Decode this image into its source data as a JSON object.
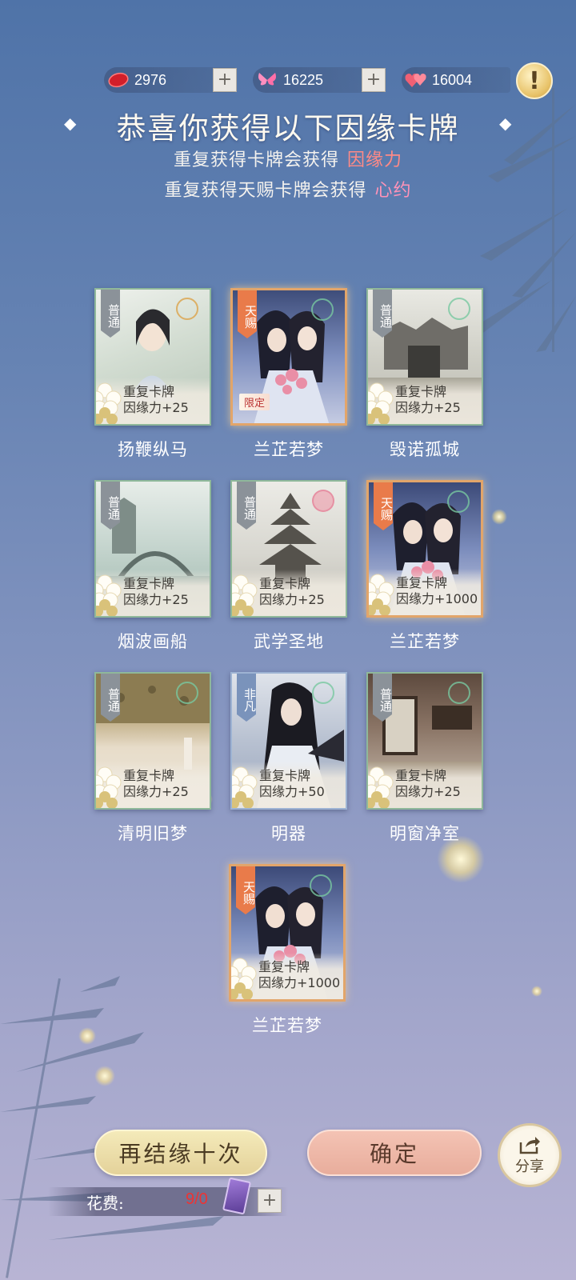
{
  "currencies": [
    {
      "icon": "red-gem-icon",
      "value": "2976",
      "has_plus": true
    },
    {
      "icon": "butterfly-icon",
      "value": "16225",
      "has_plus": true
    },
    {
      "icon": "hearts-icon",
      "value": "16004",
      "has_plus": false
    }
  ],
  "info_button": {
    "label": "!"
  },
  "header": {
    "title": "恭喜你获得以下因缘卡牌",
    "line1_text": "重复获得卡牌会获得",
    "line1_highlight": "因缘力",
    "line2_text": "重复获得天赐卡牌会获得",
    "line2_highlight": "心约"
  },
  "cards": [
    {
      "name": "扬鞭纵马",
      "rarity": "普通",
      "repeat_label": "重复卡牌",
      "repeat_value": "因缘力+25"
    },
    {
      "name": "兰芷若梦",
      "rarity": "天赐",
      "limited": "限定"
    },
    {
      "name": "毁诺孤城",
      "rarity": "普通",
      "repeat_label": "重复卡牌",
      "repeat_value": "因缘力+25"
    },
    {
      "name": "烟波画船",
      "rarity": "普通",
      "repeat_label": "重复卡牌",
      "repeat_value": "因缘力+25"
    },
    {
      "name": "武学圣地",
      "rarity": "普通",
      "repeat_label": "重复卡牌",
      "repeat_value": "因缘力+25"
    },
    {
      "name": "兰芷若梦",
      "rarity": "天赐",
      "repeat_label": "重复卡牌",
      "repeat_value": "因缘力+1000"
    },
    {
      "name": "清明旧梦",
      "rarity": "普通",
      "repeat_label": "重复卡牌",
      "repeat_value": "因缘力+25"
    },
    {
      "name": "明器",
      "rarity": "非凡",
      "repeat_label": "重复卡牌",
      "repeat_value": "因缘力+50"
    },
    {
      "name": "明窗净室",
      "rarity": "普通",
      "repeat_label": "重复卡牌",
      "repeat_value": "因缘力+25"
    },
    {
      "name": "兰芷若梦",
      "rarity": "天赐",
      "repeat_label": "重复卡牌",
      "repeat_value": "因缘力+1000"
    }
  ],
  "actions": {
    "again_label": "再结缘十次",
    "confirm_label": "确定",
    "share_label": "分享"
  },
  "cost": {
    "label": "花费:",
    "value": "9/0"
  },
  "colors": {
    "highlight_red": "#ff8a86",
    "highlight_pink": "#ff93b8",
    "cost_red": "#e33333"
  }
}
